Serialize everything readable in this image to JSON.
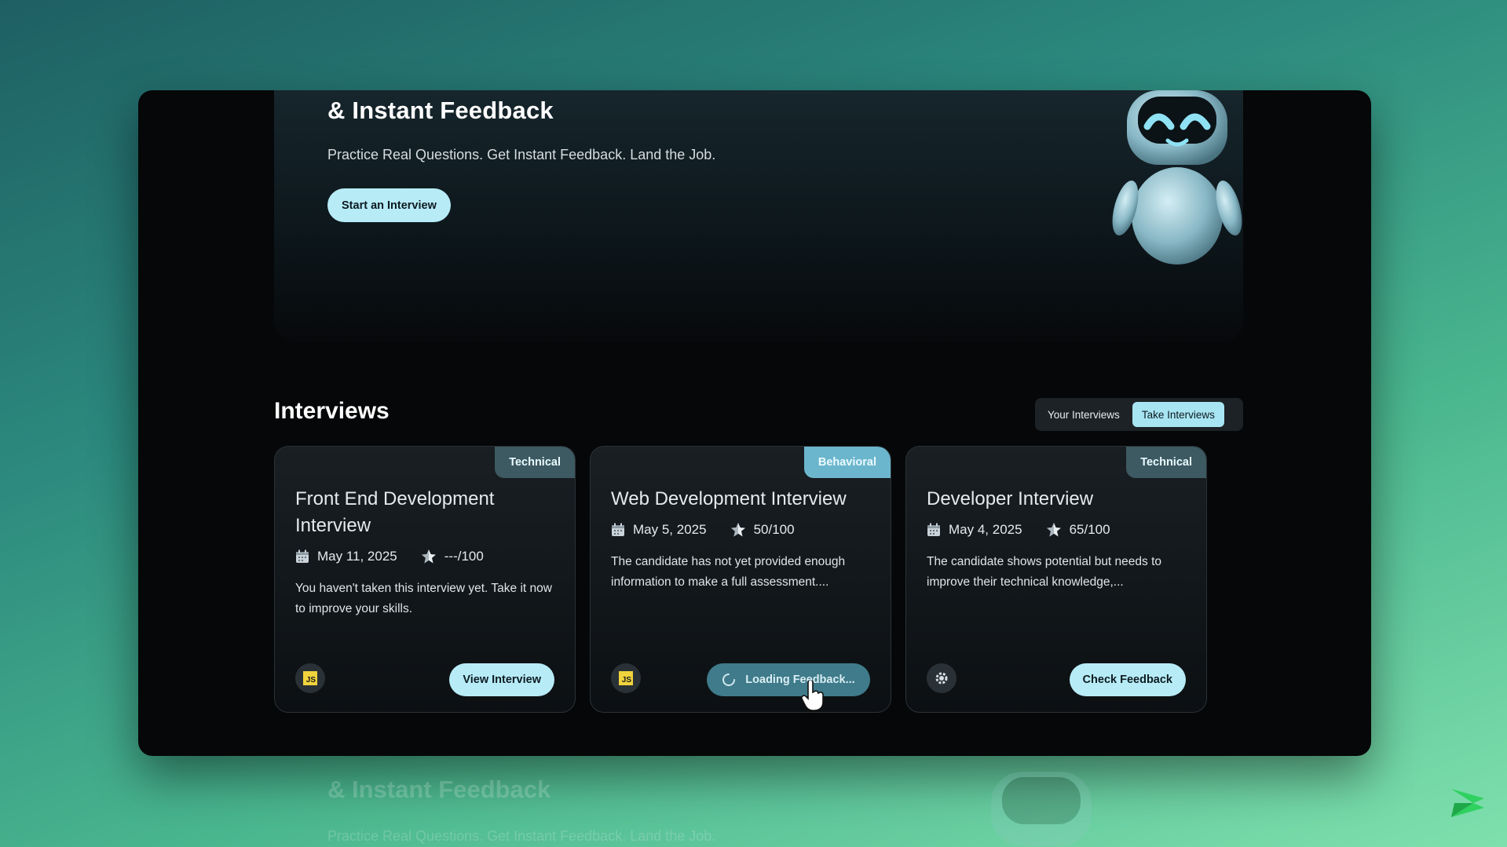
{
  "hero": {
    "title": "& Instant Feedback",
    "subtitle": "Practice Real Questions. Get Instant Feedback. Land the Job.",
    "start_button": "Start an Interview"
  },
  "interviews": {
    "title": "Interviews",
    "tabs": [
      {
        "label": "Your Interviews",
        "active": false
      },
      {
        "label": "Take Interviews",
        "active": true
      }
    ],
    "cards": [
      {
        "badge": "Technical",
        "title": "Front End Development Interview",
        "date": "May 11, 2025",
        "score": "---/100",
        "description": "You haven't taken this interview yet. Take it now to improve your skills.",
        "tech_icon": "javascript-icon",
        "button": "View Interview"
      },
      {
        "badge": "Behavioral",
        "title": "Web Development Interview",
        "date": "May 5, 2025",
        "score": "50/100",
        "description": "The candidate has not yet provided enough information to make a full assessment....",
        "tech_icon": "javascript-icon",
        "button": "Loading Feedback..."
      },
      {
        "badge": "Technical",
        "title": "Developer Interview",
        "date": "May 4, 2025",
        "score": "65/100",
        "description": "The candidate shows potential but needs to improve their technical knowledge,...",
        "tech_icon": "gear-icon",
        "button": "Check Feedback"
      }
    ]
  },
  "reflection": {
    "title": "& Instant Feedback",
    "subtitle": "Practice Real Questions. Get Instant Feedback. Land the Job."
  },
  "colors": {
    "accent": "#b7ecf7",
    "badge_technical": "#3d5962",
    "badge_behavioral": "#6cb6cd",
    "loading_button": "#3f7b8a"
  }
}
